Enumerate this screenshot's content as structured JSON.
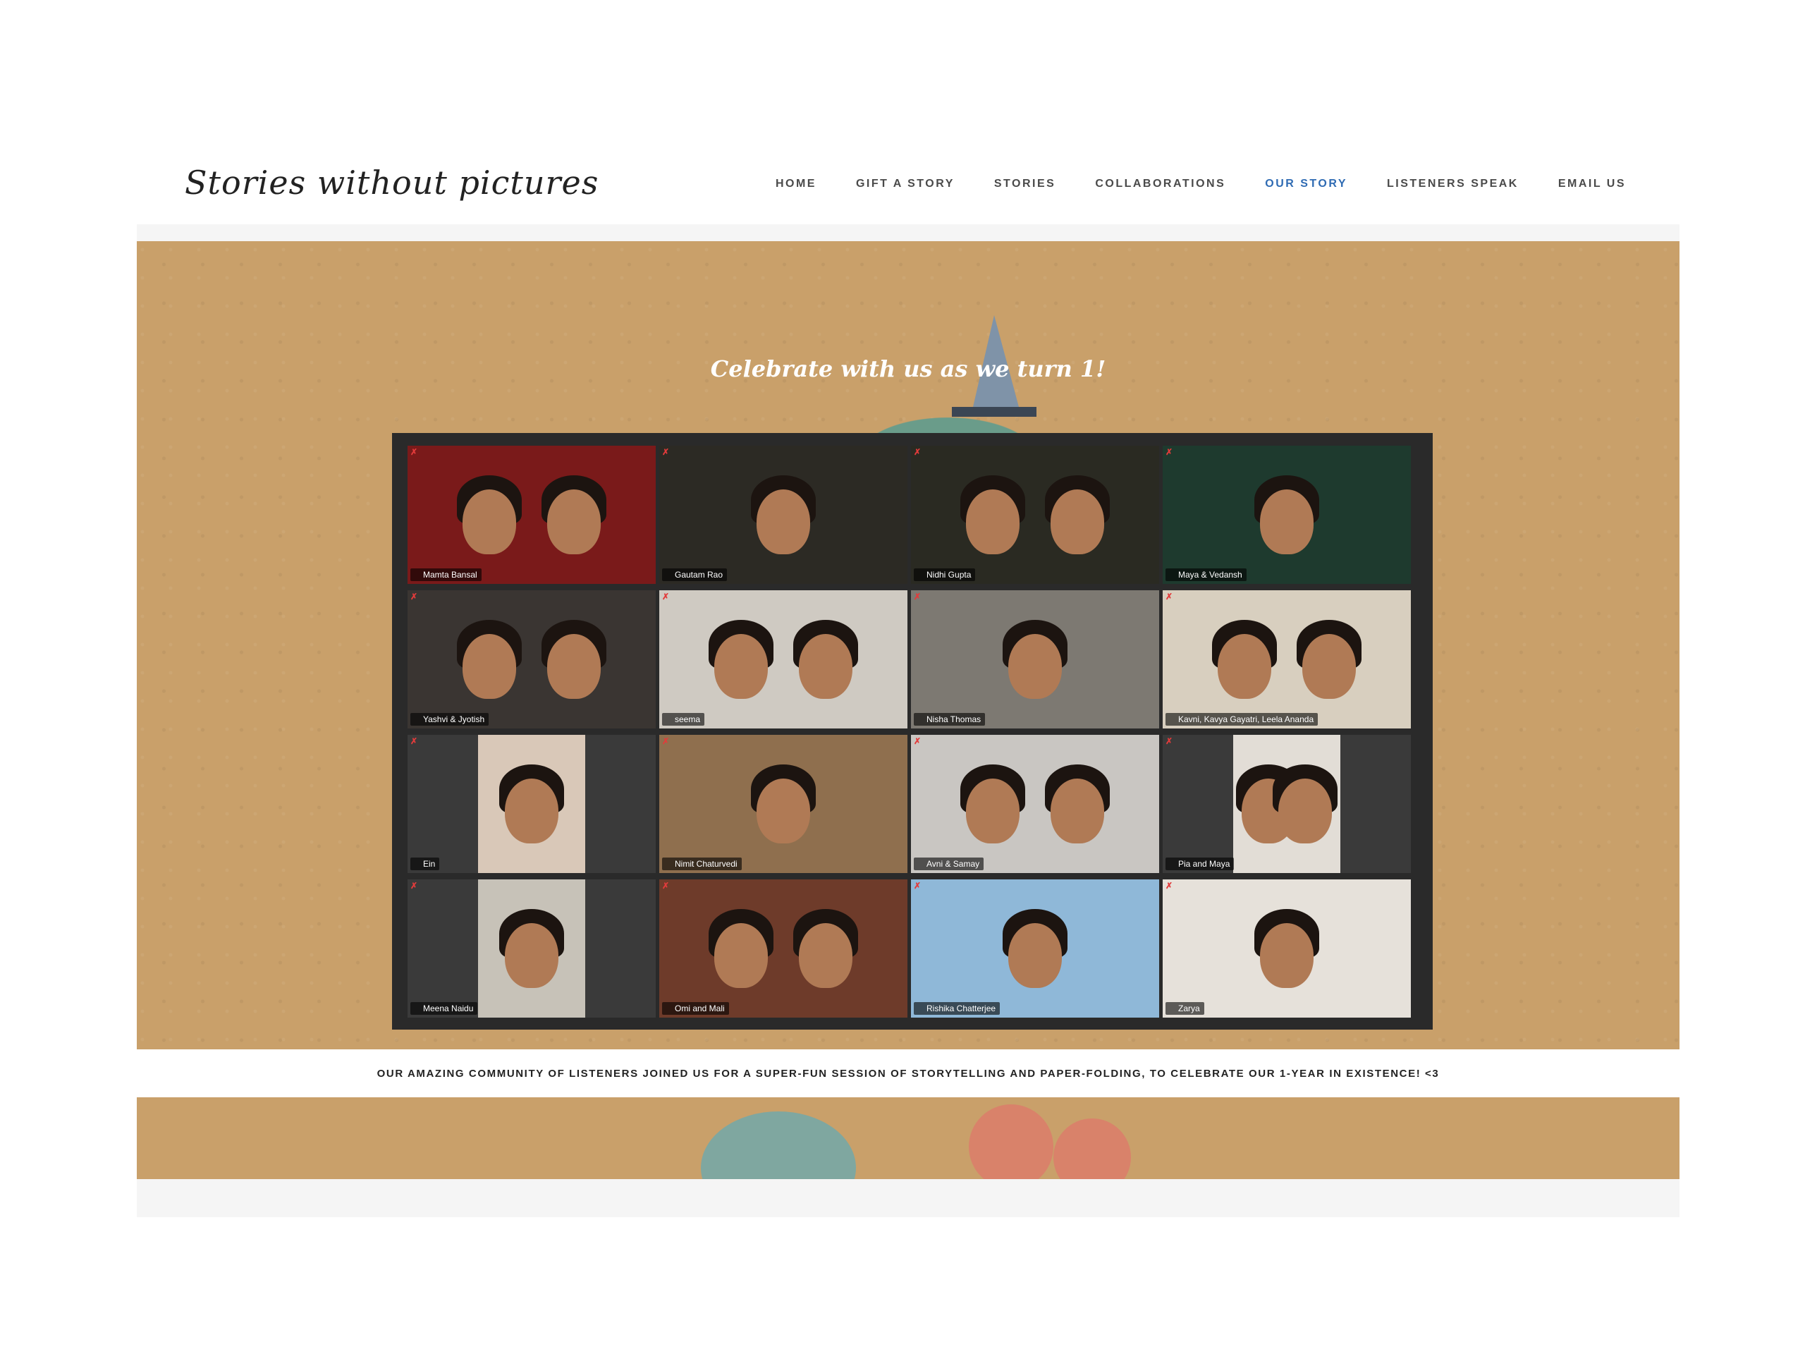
{
  "header": {
    "logo": "Stories without pictures",
    "nav": [
      {
        "label": "HOME",
        "active": false
      },
      {
        "label": "GIFT A STORY",
        "active": false
      },
      {
        "label": "STORIES",
        "active": false
      },
      {
        "label": "COLLABORATIONS",
        "active": false
      },
      {
        "label": "OUR STORY",
        "active": true
      },
      {
        "label": "LISTENERS SPEAK",
        "active": false
      },
      {
        "label": "EMAIL US",
        "active": false
      }
    ]
  },
  "hero": {
    "headline": "Celebrate with us as we turn 1!",
    "participants": [
      {
        "name": "Mamta Bansal",
        "bg": "#7a1a1a",
        "speaking": false,
        "narrow": false,
        "people": 2
      },
      {
        "name": "Gautam Rao",
        "bg": "#2c2a24",
        "speaking": false,
        "narrow": false,
        "people": 1
      },
      {
        "name": "Nidhi Gupta",
        "bg": "#2a2a22",
        "speaking": true,
        "narrow": false,
        "people": 2
      },
      {
        "name": "Maya & Vedansh",
        "bg": "#1e3a2e",
        "speaking": false,
        "narrow": false,
        "people": 1
      },
      {
        "name": "Yashvi & Jyotish",
        "bg": "#3a3532",
        "speaking": false,
        "narrow": false,
        "people": 2
      },
      {
        "name": "seema",
        "bg": "#cfcac2",
        "speaking": false,
        "narrow": false,
        "people": 2
      },
      {
        "name": "Nisha Thomas",
        "bg": "#7d7972",
        "speaking": false,
        "narrow": false,
        "people": 1
      },
      {
        "name": "Kavni, Kavya Gayatri, Leela Ananda",
        "bg": "#d8cfbf",
        "speaking": false,
        "narrow": false,
        "people": 2
      },
      {
        "name": "Ein",
        "bg": "#d9c8b8",
        "speaking": false,
        "narrow": true,
        "people": 1
      },
      {
        "name": "Nimit Chaturvedi",
        "bg": "#8f6f4e",
        "speaking": false,
        "narrow": false,
        "people": 1
      },
      {
        "name": "Avni & Samay",
        "bg": "#c9c6c2",
        "speaking": false,
        "narrow": false,
        "people": 2
      },
      {
        "name": "Pia and Maya",
        "bg": "#e2ddd6",
        "speaking": false,
        "narrow": true,
        "people": 2
      },
      {
        "name": "Meena Naidu",
        "bg": "#c7c2b8",
        "speaking": false,
        "narrow": true,
        "people": 1
      },
      {
        "name": "Omi and Mali",
        "bg": "#6e3b2a",
        "speaking": false,
        "narrow": false,
        "people": 2
      },
      {
        "name": "Rishika Chatterjee",
        "bg": "#8fb8d8",
        "speaking": false,
        "narrow": false,
        "people": 1
      },
      {
        "name": "Zarya",
        "bg": "#e6e1da",
        "speaking": false,
        "narrow": false,
        "people": 1
      }
    ]
  },
  "caption": "OUR AMAZING COMMUNITY OF LISTENERS JOINED US FOR A SUPER-FUN SESSION OF STORYTELLING AND PAPER-FOLDING, TO CELEBRATE OUR 1-YEAR IN EXISTENCE! <3",
  "colors": {
    "kraft": "#c9a06a",
    "active_nav": "#2f6bb3",
    "zoom_bg": "#2a2a2a",
    "speaker_outline": "#e3e07a"
  },
  "icons": {
    "mute": "mic-muted-icon"
  }
}
